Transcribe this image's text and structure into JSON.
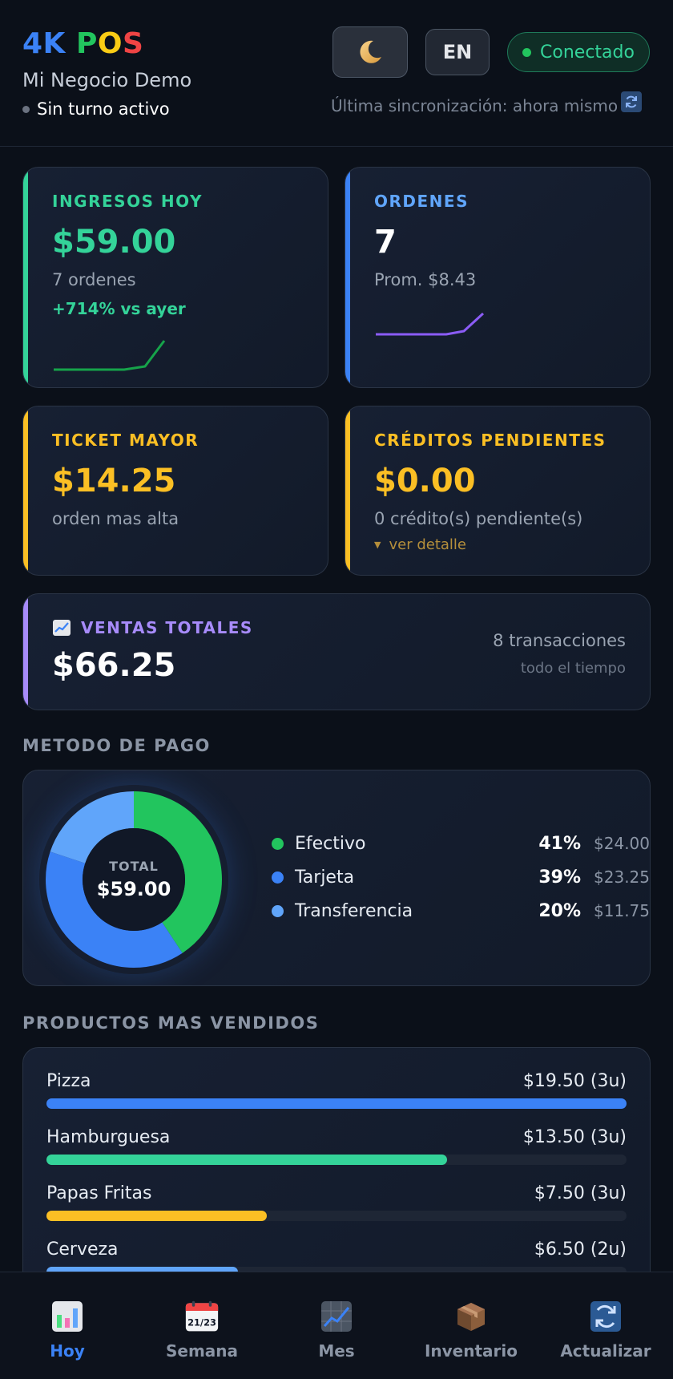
{
  "header": {
    "brand_4k": "4K",
    "brand_p": "P",
    "brand_o": "O",
    "brand_s": "S",
    "business_name": "Mi Negocio Demo",
    "shift_status": "Sin turno activo",
    "lang_button": "EN",
    "connection_status": "Conectado",
    "last_sync": "Última sincronización: ahora mismo"
  },
  "cards": {
    "income": {
      "label": "INGRESOS HOY",
      "value": "$59.00",
      "sub": "7 ordenes",
      "trend": "+714% vs ayer",
      "color": "#34d399"
    },
    "orders": {
      "label": "ORDENES",
      "value": "7",
      "sub": "Prom. $8.43",
      "color": "#60a5fa"
    },
    "top_ticket": {
      "label": "TICKET MAYOR",
      "value": "$14.25",
      "sub": "orden mas alta",
      "color": "#fbbf24"
    },
    "credits": {
      "label": "CRÉDITOS PENDIENTES",
      "value": "$0.00",
      "sub": "0 crédito(s) pendiente(s)",
      "detail": "ver detalle",
      "color": "#fbbf24"
    },
    "total_sales": {
      "label": "VENTAS TOTALES",
      "value": "$66.25",
      "transactions": "8 transacciones",
      "period": "todo el tiempo",
      "color": "#a78bfa"
    }
  },
  "payment": {
    "section_title": "METODO DE PAGO",
    "center_label": "TOTAL",
    "center_value": "$59.00",
    "methods": [
      {
        "name": "Efectivo",
        "pct": "41%",
        "amount": "$24.00",
        "value": 24.0,
        "color": "#22c55e"
      },
      {
        "name": "Tarjeta",
        "pct": "39%",
        "amount": "$23.25",
        "value": 23.25,
        "color": "#3b82f6"
      },
      {
        "name": "Transferencia",
        "pct": "20%",
        "amount": "$11.75",
        "value": 11.75,
        "color": "#60a5fa"
      }
    ]
  },
  "products": {
    "section_title": "PRODUCTOS MAS VENDIDOS",
    "items": [
      {
        "name": "Pizza",
        "amount": "$19.50 (3u)",
        "share": 1.0,
        "color": "#3b82f6"
      },
      {
        "name": "Hamburguesa",
        "amount": "$13.50 (3u)",
        "share": 0.69,
        "color": "#34d399"
      },
      {
        "name": "Papas Fritas",
        "amount": "$7.50 (3u)",
        "share": 0.38,
        "color": "#fbbf24"
      },
      {
        "name": "Cerveza",
        "amount": "$6.50 (2u)",
        "share": 0.33,
        "color": "#60a5fa"
      }
    ]
  },
  "nav": [
    {
      "label": "Hoy",
      "icon": "bar-chart-icon",
      "active": true
    },
    {
      "label": "Semana",
      "icon": "calendar-icon",
      "calendar_text": "21/23",
      "active": false
    },
    {
      "label": "Mes",
      "icon": "line-chart-icon",
      "active": false
    },
    {
      "label": "Inventario",
      "icon": "package-icon",
      "active": false
    },
    {
      "label": "Actualizar",
      "icon": "refresh-icon",
      "active": false
    }
  ]
}
